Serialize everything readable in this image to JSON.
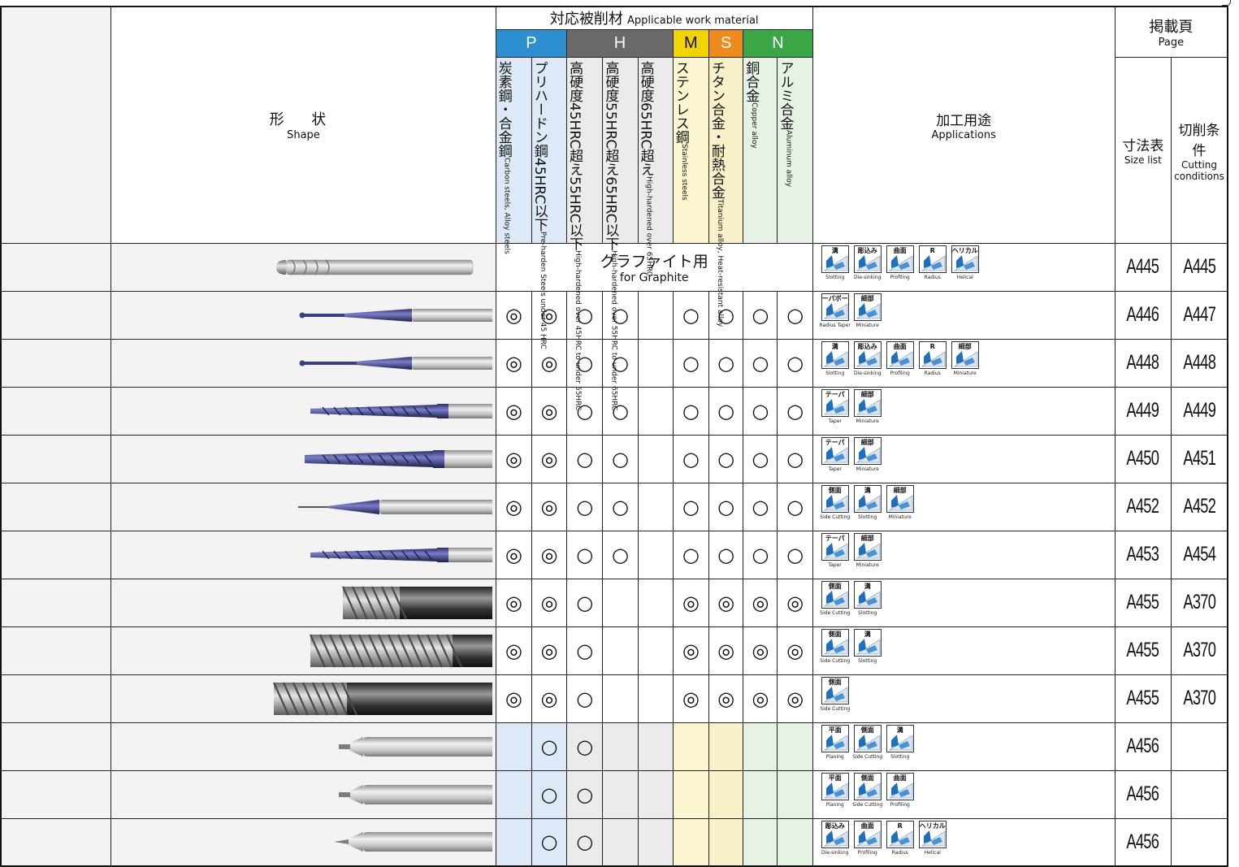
{
  "header": {
    "shape_jp": "形 状",
    "shape_en": "Shape",
    "material_title_jp": "対応被削材",
    "material_title_en": "Applicable work material",
    "groups": [
      "P",
      "H",
      "M",
      "S",
      "N"
    ],
    "materials": [
      {
        "jp": "炭素鋼・合金鋼",
        "en": "Carbon steels, Alloy steels"
      },
      {
        "jp": "プリハードン鋼45HRC以下",
        "en": "Pre-harden Steels under 45 HRC"
      },
      {
        "jp": "高硬度45HRC超え55HRC以下",
        "en": "High-hardened over 45HRC to under 55HRC"
      },
      {
        "jp": "高硬度55HRC超え65HRC以下",
        "en": "High-hardened over 55HRC to under 65HRC"
      },
      {
        "jp": "高硬度65HRC超え",
        "en": "High-hardened over 65HRC"
      },
      {
        "jp": "ステンレス鋼",
        "en": "Stainless steels"
      },
      {
        "jp": "チタン合金・耐熱合金",
        "en": "Titanium alloy, Heat-resistant alloy"
      },
      {
        "jp": "銅合金",
        "en": "Copper alloy"
      },
      {
        "jp": "アルミ合金",
        "en": "Aluminum alloy"
      }
    ],
    "applications_jp": "加工用途",
    "applications_en": "Applications",
    "page_jp": "掲載頁",
    "page_en": "Page",
    "size_jp": "寸法表",
    "size_en": "Size list",
    "cond_jp": "切削条件",
    "cond_en1": "Cutting",
    "cond_en2": "conditions"
  },
  "graphite": {
    "jp": "グラファイト用",
    "en": "for Graphite"
  },
  "rows": [
    {
      "tool": "ball-long",
      "graphite": true,
      "marks": [],
      "apps": [
        {
          "jp": "溝",
          "en": "Slotting"
        },
        {
          "jp": "彫込み",
          "en": "Die-sinking"
        },
        {
          "jp": "曲面",
          "en": "Profiling"
        },
        {
          "jp": "R",
          "en": "Radius"
        },
        {
          "jp": "ヘリカル",
          "en": "Helical"
        }
      ],
      "size": "A445",
      "cond": "A445"
    },
    {
      "tool": "taper-ball",
      "marks": [
        "◎",
        "◎",
        "○",
        "○",
        "",
        "○",
        "○",
        "○",
        "○"
      ],
      "apps": [
        {
          "jp": "テーパボール",
          "en": "Radius Taper"
        },
        {
          "jp": "細部",
          "en": "Miniature"
        }
      ],
      "size": "A446",
      "cond": "A447"
    },
    {
      "tool": "long-neck-ball",
      "marks": [
        "◎",
        "◎",
        "○",
        "○",
        "",
        "○",
        "○",
        "○",
        "○"
      ],
      "apps": [
        {
          "jp": "溝",
          "en": "Slotting"
        },
        {
          "jp": "彫込み",
          "en": "Die-sinking"
        },
        {
          "jp": "曲面",
          "en": "Profiling"
        },
        {
          "jp": "R",
          "en": "Radius"
        },
        {
          "jp": "細部",
          "en": "Miniature"
        }
      ],
      "size": "A448",
      "cond": "A448"
    },
    {
      "tool": "taper-square",
      "marks": [
        "◎",
        "◎",
        "○",
        "○",
        "",
        "○",
        "○",
        "○",
        "○"
      ],
      "apps": [
        {
          "jp": "テーパ",
          "en": "Taper"
        },
        {
          "jp": "細部",
          "en": "Miniature"
        }
      ],
      "size": "A449",
      "cond": "A449"
    },
    {
      "tool": "taper-square-2",
      "marks": [
        "◎",
        "◎",
        "○",
        "○",
        "",
        "○",
        "○",
        "○",
        "○"
      ],
      "apps": [
        {
          "jp": "テーパ",
          "en": "Taper"
        },
        {
          "jp": "細部",
          "en": "Miniature"
        }
      ],
      "size": "A450",
      "cond": "A451"
    },
    {
      "tool": "micro",
      "marks": [
        "◎",
        "◎",
        "○",
        "○",
        "",
        "○",
        "○",
        "○",
        "○"
      ],
      "apps": [
        {
          "jp": "側面",
          "en": "Side Cutting"
        },
        {
          "jp": "溝",
          "en": "Slotting"
        },
        {
          "jp": "細部",
          "en": "Miniature"
        }
      ],
      "size": "A452",
      "cond": "A452"
    },
    {
      "tool": "taper-square",
      "marks": [
        "◎",
        "◎",
        "○",
        "○",
        "",
        "○",
        "○",
        "○",
        "○"
      ],
      "apps": [
        {
          "jp": "テーパ",
          "en": "Taper"
        },
        {
          "jp": "細部",
          "en": "Miniature"
        }
      ],
      "size": "A453",
      "cond": "A454"
    },
    {
      "tool": "rough-short",
      "marks": [
        "◎",
        "◎",
        "○",
        "",
        "",
        "◎",
        "◎",
        "◎",
        "◎"
      ],
      "apps": [
        {
          "jp": "側面",
          "en": "Side Cutting"
        },
        {
          "jp": "溝",
          "en": "Slotting"
        }
      ],
      "size": "A455",
      "cond": "A370"
    },
    {
      "tool": "rough-mid",
      "marks": [
        "◎",
        "◎",
        "○",
        "",
        "",
        "◎",
        "◎",
        "◎",
        "◎"
      ],
      "apps": [
        {
          "jp": "側面",
          "en": "Side Cutting"
        },
        {
          "jp": "溝",
          "en": "Slotting"
        }
      ],
      "size": "A455",
      "cond": "A370"
    },
    {
      "tool": "rough-long",
      "marks": [
        "◎",
        "◎",
        "○",
        "",
        "",
        "◎",
        "◎",
        "◎",
        "◎"
      ],
      "apps": [
        {
          "jp": "側面",
          "en": "Side Cutting"
        }
      ],
      "size": "A455",
      "cond": "A370"
    },
    {
      "tool": "shank-tip",
      "marks": [
        "",
        "○",
        "○",
        "",
        "",
        "",
        "",
        "",
        ""
      ],
      "apps": [
        {
          "jp": "平面",
          "en": "Planing"
        },
        {
          "jp": "側面",
          "en": "Side Cutting"
        },
        {
          "jp": "溝",
          "en": "Slotting"
        }
      ],
      "size": "A456",
      "cond": ""
    },
    {
      "tool": "shank-tip",
      "marks": [
        "",
        "○",
        "○",
        "",
        "",
        "",
        "",
        "",
        ""
      ],
      "apps": [
        {
          "jp": "平面",
          "en": "Planing"
        },
        {
          "jp": "側面",
          "en": "Side Cutting"
        },
        {
          "jp": "曲面",
          "en": "Profiling"
        }
      ],
      "size": "A456",
      "cond": ""
    },
    {
      "tool": "shank-point",
      "marks": [
        "",
        "○",
        "○",
        "",
        "",
        "",
        "",
        "",
        ""
      ],
      "apps": [
        {
          "jp": "彫込み",
          "en": "Die-sinking"
        },
        {
          "jp": "曲面",
          "en": "Profiling"
        },
        {
          "jp": "R",
          "en": "Radius"
        },
        {
          "jp": "ヘリカル",
          "en": "Helical"
        }
      ],
      "size": "A456",
      "cond": ""
    }
  ]
}
